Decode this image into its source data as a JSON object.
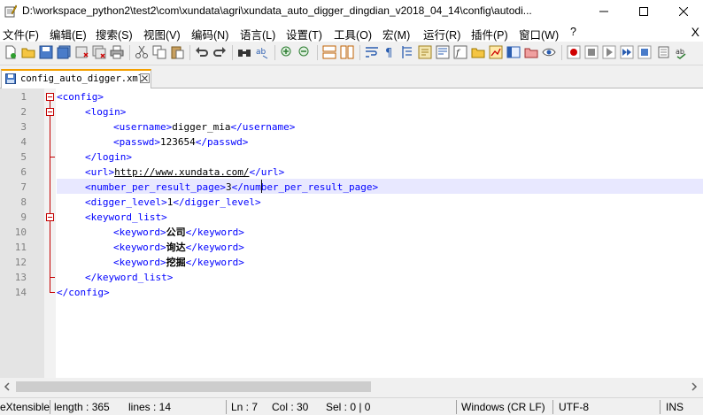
{
  "window": {
    "title": "D:\\workspace_python2\\test2\\com\\xundata\\agri\\xundata_auto_digger_dingdian_v2018_04_14\\config\\autodi...",
    "minimize_glyph": "—",
    "maximize_glyph": "☐",
    "close_glyph": "✕"
  },
  "menu": {
    "items": [
      "文件(F)",
      "编辑(E)",
      "搜索(S)",
      "视图(V)",
      "编码(N)",
      "语言(L)",
      "设置(T)",
      "工具(O)",
      "宏(M)",
      "运行(R)",
      "插件(P)",
      "窗口(W)",
      "?"
    ],
    "close_glyph": "X"
  },
  "tab": {
    "label": "config_auto_digger.xml"
  },
  "editor": {
    "line_numbers": [
      "1",
      "2",
      "3",
      "4",
      "5",
      "6",
      "7",
      "8",
      "9",
      "10",
      "11",
      "12",
      "13",
      "14"
    ],
    "lines": {
      "l1": {
        "o": "<config>"
      },
      "l2": {
        "o": "<login>"
      },
      "l3": {
        "o": "<username>",
        "t": "digger_mia",
        "c": "</username>"
      },
      "l4": {
        "o": "<passwd>",
        "t": "123654",
        "c": "</passwd>"
      },
      "l5": {
        "o": "</login>"
      },
      "l6": {
        "o": "<url>",
        "t": "http://www.xundata.com/",
        "c": "</url>"
      },
      "l7": {
        "o": "<number_per_result_page>",
        "t": "3",
        "c": "</number_per_result_page>"
      },
      "l8": {
        "o": "<digger_level>",
        "t": "1",
        "c": "</digger_level>"
      },
      "l9": {
        "o": "<keyword_list>"
      },
      "l10": {
        "o": "<keyword>",
        "t": "公司",
        "c": "</keyword>"
      },
      "l11": {
        "o": "<keyword>",
        "t": "询达",
        "c": "</keyword>"
      },
      "l12": {
        "o": "<keyword>",
        "t": "挖掘",
        "c": "</keyword>"
      },
      "l13": {
        "o": "</keyword_list>"
      },
      "l14": {
        "o": "</config>"
      }
    }
  },
  "status": {
    "file_type": "eXtensible",
    "length": "length : 365",
    "lines": "lines : 14",
    "ln": "Ln : 7",
    "col": "Col : 30",
    "sel": "Sel : 0 | 0",
    "eol": "Windows (CR LF)",
    "encoding": "UTF-8",
    "mode": "INS"
  }
}
